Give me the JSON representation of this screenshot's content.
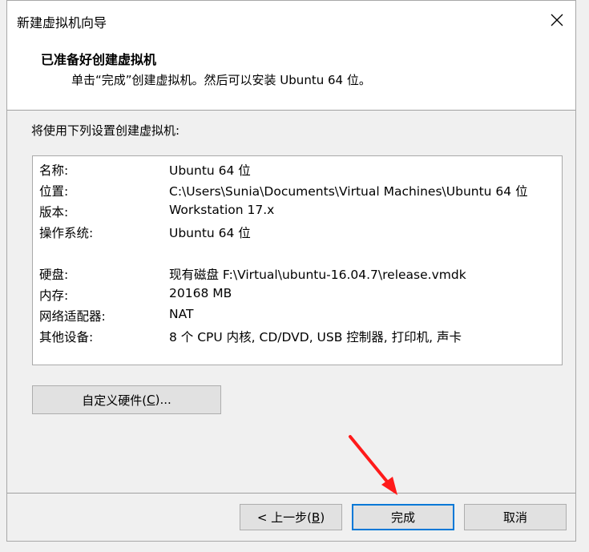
{
  "window": {
    "title": "新建虚拟机向导"
  },
  "header": {
    "title": "已准备好创建虚拟机",
    "subtitle": "单击“完成”创建虚拟机。然后可以安装 Ubuntu 64 位。"
  },
  "main": {
    "section_label": "将使用下列设置创建虚拟机:",
    "settings": [
      {
        "key": "名称:",
        "value": "Ubuntu 64 位"
      },
      {
        "key": "位置:",
        "value": "C:\\Users\\Sunia\\Documents\\Virtual Machines\\Ubuntu 64 位"
      },
      {
        "key": "版本:",
        "value": "Workstation 17.x"
      },
      {
        "key": "操作系统:",
        "value": "Ubuntu 64 位"
      },
      {
        "key": "硬盘:",
        "value": "现有磁盘 F:\\Virtual\\ubuntu-16.04.7\\release.vmdk"
      },
      {
        "key": "内存:",
        "value": "20168 MB"
      },
      {
        "key": "网络适配器:",
        "value": "NAT"
      },
      {
        "key": "其他设备:",
        "value": "8 个 CPU 内核, CD/DVD, USB 控制器, 打印机, 声卡"
      }
    ],
    "customize_label": "自定义硬件(",
    "customize_mnemonic": "C",
    "customize_suffix": ")..."
  },
  "footer": {
    "back_prefix": "< 上一步(",
    "back_mnemonic": "B",
    "back_suffix": ")",
    "finish_label": "完成",
    "cancel_label": "取消"
  },
  "icons": {
    "close": "close-icon",
    "annotation": "red-arrow-icon"
  },
  "colors": {
    "accent": "#0078d7",
    "annotation_arrow": "#ff1a1a"
  }
}
